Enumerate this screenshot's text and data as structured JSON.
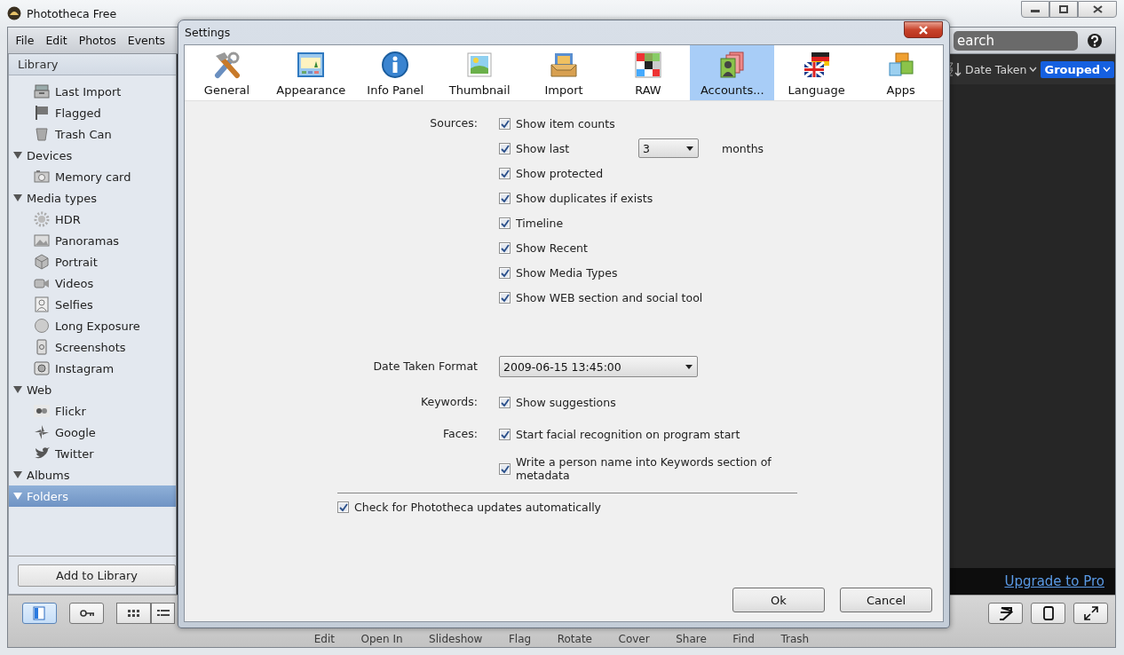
{
  "window": {
    "title": "Phototheca Free"
  },
  "menu": [
    "File",
    "Edit",
    "Photos",
    "Events"
  ],
  "search": {
    "placeholder": "earch"
  },
  "sidebar": {
    "header": "Library",
    "library_items": [
      {
        "label": "Last Import"
      },
      {
        "label": "Flagged"
      },
      {
        "label": "Trash Can"
      }
    ],
    "sections": [
      {
        "label": "Devices",
        "expanded": true,
        "selected": false,
        "children": [
          {
            "label": "Memory card"
          }
        ]
      },
      {
        "label": "Media types",
        "expanded": true,
        "selected": false,
        "children": [
          {
            "label": "HDR"
          },
          {
            "label": "Panoramas"
          },
          {
            "label": "Portrait"
          },
          {
            "label": "Videos"
          },
          {
            "label": "Selfies"
          },
          {
            "label": "Long Exposure"
          },
          {
            "label": "Screenshots"
          },
          {
            "label": "Instagram"
          }
        ]
      },
      {
        "label": "Web",
        "expanded": true,
        "selected": false,
        "children": [
          {
            "label": "Flickr"
          },
          {
            "label": "Google"
          },
          {
            "label": "Twitter"
          }
        ]
      },
      {
        "label": "Albums",
        "expanded": true,
        "selected": false
      },
      {
        "label": "Folders",
        "expanded": true,
        "selected": true
      }
    ],
    "add_button": "Add to Library"
  },
  "viewer": {
    "sort": "Date Taken",
    "grouping": "Grouped",
    "upgrade_link": "Upgrade to Pro"
  },
  "toolbar": {
    "view_buttons": [
      {
        "selected": true
      },
      {
        "selected": false
      },
      {
        "selected": false
      },
      {
        "selected": false
      }
    ],
    "actions": [
      "Edit",
      "Open In",
      "Slideshow",
      "Flag",
      "Rotate",
      "Cover",
      "Share",
      "Find",
      "Trash"
    ]
  },
  "dialog": {
    "title": "Settings",
    "tabs": [
      {
        "label": "General",
        "selected": false
      },
      {
        "label": "Appearance",
        "selected": false
      },
      {
        "label": "Info Panel",
        "selected": false
      },
      {
        "label": "Thumbnail",
        "selected": false
      },
      {
        "label": "Import",
        "selected": false
      },
      {
        "label": "RAW",
        "selected": false
      },
      {
        "label": "Accounts...",
        "selected": true
      },
      {
        "label": "Language",
        "selected": false
      },
      {
        "label": "Apps",
        "selected": false
      }
    ],
    "groups": [
      {
        "kind": "checkboxes",
        "label": "Sources:",
        "options": [
          {
            "label": "Show item counts",
            "checked": true
          },
          {
            "label": "Show last",
            "checked": true,
            "select": "3",
            "suffix": "months"
          },
          {
            "label": "Show protected",
            "checked": true
          },
          {
            "label": "Show duplicates if exists",
            "checked": true
          },
          {
            "label": "Timeline",
            "checked": true
          },
          {
            "label": "Show Recent",
            "checked": true
          },
          {
            "label": "Show Media Types",
            "checked": true
          },
          {
            "label": "Show WEB section and social tool",
            "checked": true
          }
        ]
      },
      {
        "kind": "dropdown",
        "label": "Date Taken Format",
        "value": "2009-06-15 13:45:00"
      },
      {
        "kind": "checkboxes",
        "label": "Keywords:",
        "options": [
          {
            "label": "Show suggestions",
            "checked": true
          }
        ]
      },
      {
        "kind": "checkboxes",
        "label": "Faces:",
        "options": [
          {
            "label": "Start facial recognition on program start",
            "checked": true
          },
          {
            "label": "Write a person name into Keywords section of metadata",
            "checked": true
          }
        ]
      }
    ],
    "footer_option": {
      "label": "Check for Phototheca updates automatically",
      "checked": true
    },
    "buttons": [
      "Ok",
      "Cancel"
    ]
  }
}
